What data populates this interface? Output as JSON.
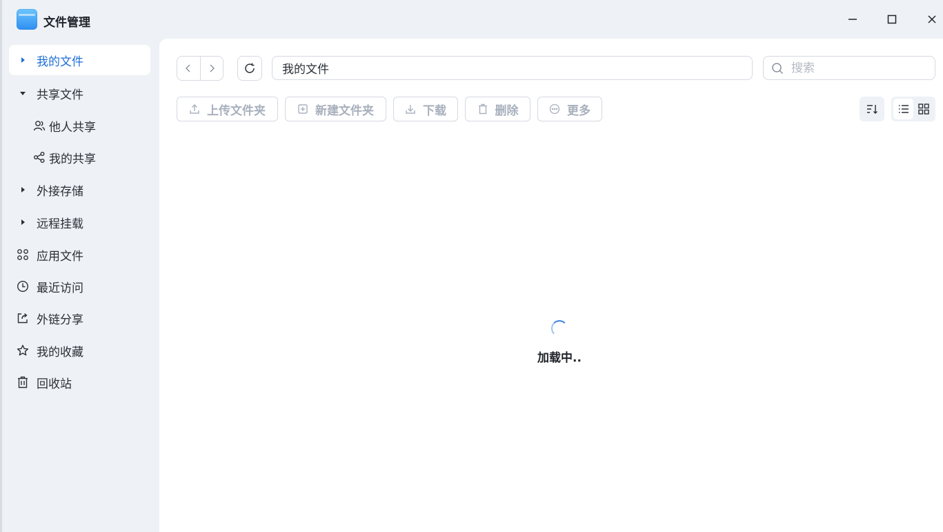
{
  "window": {
    "title": "文件管理",
    "accent": "#1f6fd6"
  },
  "sidebar": {
    "items": [
      {
        "label": "我的文件",
        "icon": "caret-right-icon",
        "active": true
      },
      {
        "label": "共享文件",
        "icon": "caret-down-icon"
      },
      {
        "label": "他人共享",
        "icon": "users-icon"
      },
      {
        "label": "我的共享",
        "icon": "share-icon"
      },
      {
        "label": "外接存储",
        "icon": "caret-right-icon"
      },
      {
        "label": "远程挂载",
        "icon": "caret-right-icon"
      },
      {
        "label": "应用文件",
        "icon": "apps-icon"
      },
      {
        "label": "最近访问",
        "icon": "clock-icon"
      },
      {
        "label": "外链分享",
        "icon": "external-share-icon"
      },
      {
        "label": "我的收藏",
        "icon": "star-icon"
      },
      {
        "label": "回收站",
        "icon": "trash-icon"
      }
    ]
  },
  "toolbar": {
    "path": "我的文件",
    "search_placeholder": "搜索",
    "upload_label": "上传文件夹",
    "newdir_label": "新建文件夹",
    "download_label": "下载",
    "delete_label": "删除",
    "more_label": "更多",
    "view_mode": "list"
  },
  "content": {
    "loading_text": "加载中.."
  }
}
